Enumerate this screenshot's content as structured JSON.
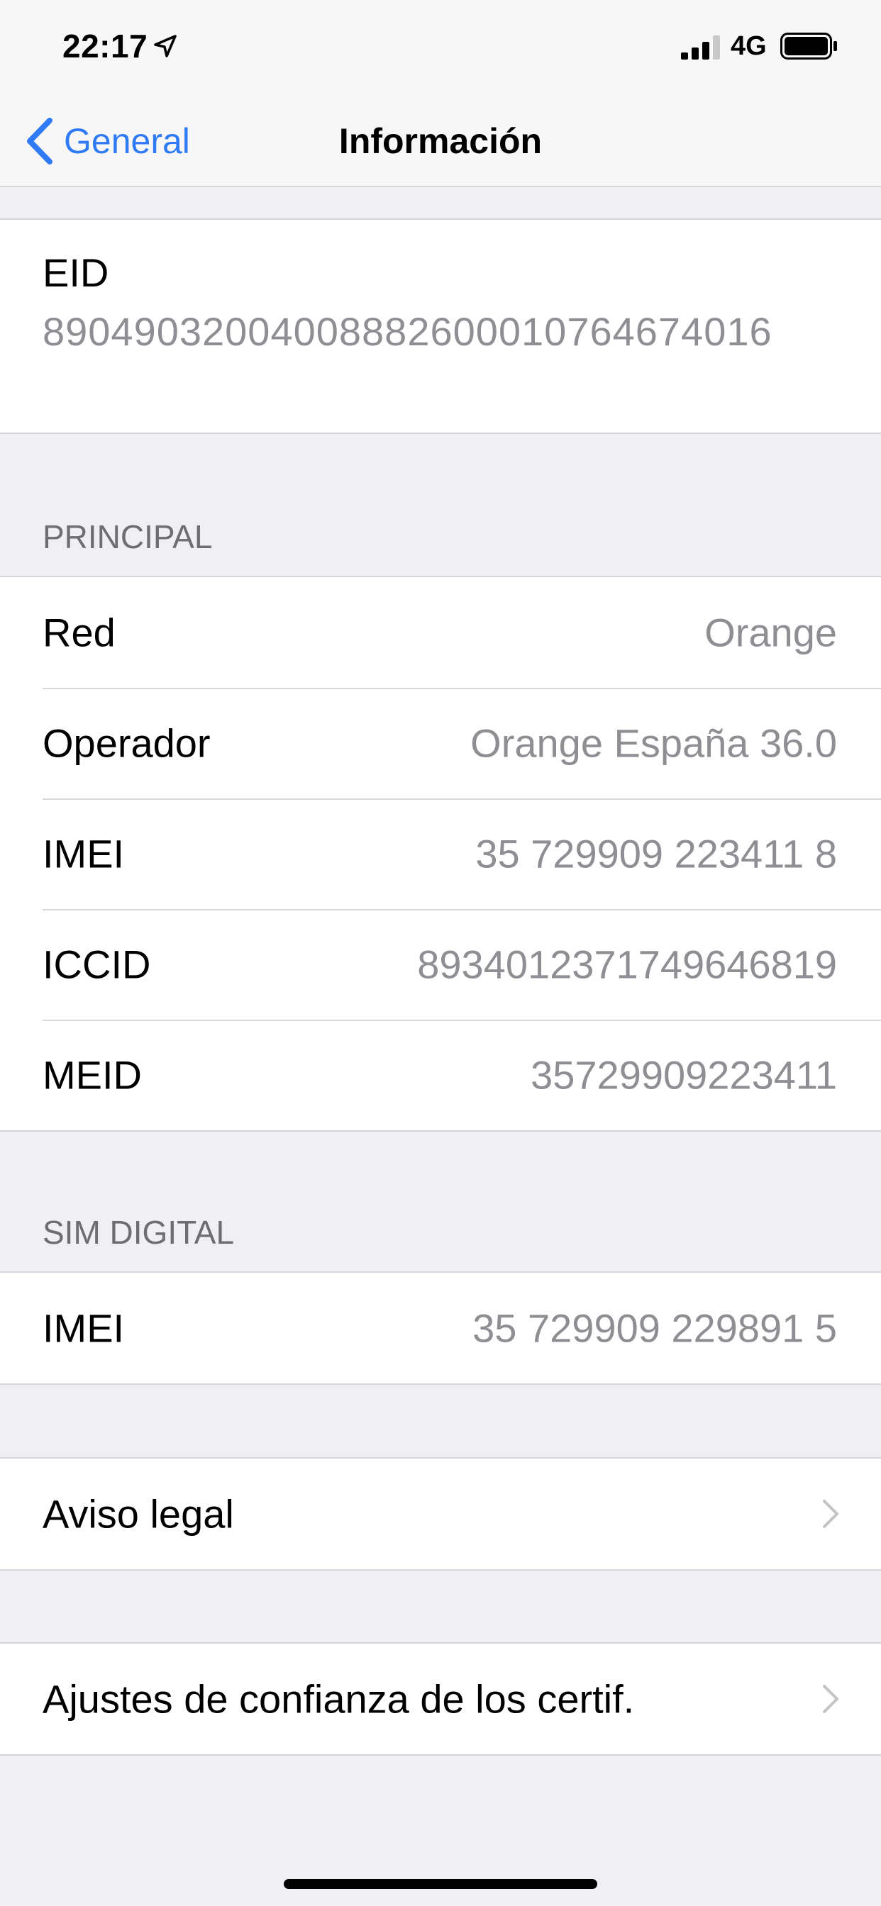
{
  "status_bar": {
    "time": "22:17",
    "network": "4G"
  },
  "nav": {
    "back_label": "General",
    "title": "Información"
  },
  "eid": {
    "label": "EID",
    "value": "89049032004008882600010764674016"
  },
  "principal": {
    "header": "PRINCIPAL",
    "rows": [
      {
        "label": "Red",
        "value": "Orange"
      },
      {
        "label": "Operador",
        "value": "Orange España 36.0"
      },
      {
        "label": "IMEI",
        "value": "35 729909 223411 8"
      },
      {
        "label": "ICCID",
        "value": "8934012371749646819"
      },
      {
        "label": "MEID",
        "value": "35729909223411"
      }
    ]
  },
  "sim_digital": {
    "header": "SIM DIGITAL",
    "rows": [
      {
        "label": "IMEI",
        "value": "35 729909 229891 5"
      }
    ]
  },
  "links": {
    "legal": "Aviso legal",
    "cert_trust": "Ajustes de confianza de los certif."
  },
  "colors": {
    "accent": "#2f7bf6",
    "secondary_text": "#8e8e93",
    "background": "#efeff4"
  }
}
